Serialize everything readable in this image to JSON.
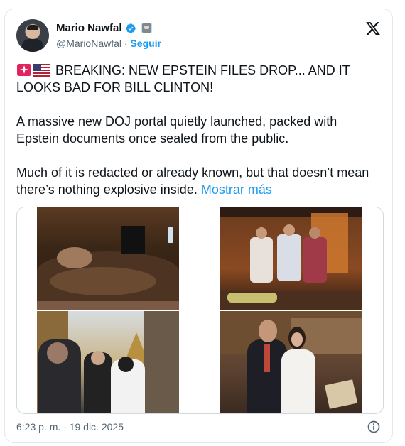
{
  "author": {
    "name": "Mario Nawfal",
    "handle": "@MarioNawfal",
    "separator": "·",
    "follow_label": "Seguir"
  },
  "icons": {
    "verified": "verified-badge-icon",
    "affiliate": "affiliate-badge-icon",
    "x_logo": "x-logo-icon",
    "siren": "police-light-icon",
    "flag": "us-flag-icon",
    "info": "info-icon"
  },
  "tweet": {
    "line1": "BREAKING: NEW EPSTEIN FILES DROP... AND IT LOOKS BAD FOR BILL CLINTON!",
    "para2": "A massive new DOJ portal quietly launched, packed with Epstein documents once sealed from the public.",
    "para3": "Much of it is redacted or already known, but that doesn’t mean there’s nothing explosive inside.",
    "show_more": "Mostrar más"
  },
  "media": [
    {
      "name": "photo-hot-tub",
      "description": "man in hot tub with redacted box"
    },
    {
      "name": "photo-group-colorful-shirts",
      "description": "group posing in colorful shirts"
    },
    {
      "name": "photo-temple-crowd",
      "description": "men in crowd near temple"
    },
    {
      "name": "photo-couple-posing",
      "description": "man in suit and woman in white"
    }
  ],
  "meta": {
    "timestamp": "6:23 p. m. · 19 dic. 2025"
  },
  "colors": {
    "accent": "#1d9bf0",
    "text": "#0f1419",
    "secondary": "#536471",
    "border": "#cfd9de"
  }
}
